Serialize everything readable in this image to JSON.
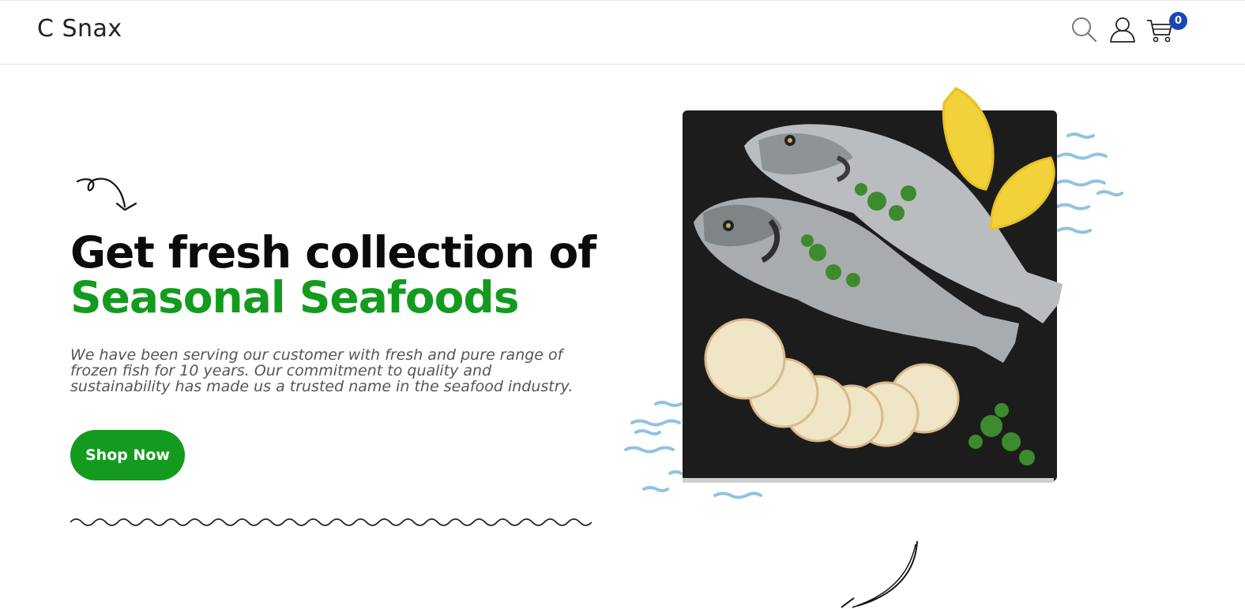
{
  "header": {
    "brand": "C Snax",
    "icons": [
      "search-icon",
      "user-icon",
      "cart-icon"
    ],
    "cart_count": "0"
  },
  "hero": {
    "headline_line1": "Get fresh collection of",
    "headline_line2": "Seasonal Seafoods",
    "description": "We have been serving our customer with fresh and pure range of frozen fish for 10 years. Our commitment to quality and sustainability has made us a trusted name in the seafood industry.",
    "cta_label": "Shop Now"
  },
  "colors": {
    "accent_green": "#149b1f",
    "badge_blue": "#1a45b5",
    "slate": "#1c1c1c",
    "water_blue": "#8fc3e3"
  }
}
